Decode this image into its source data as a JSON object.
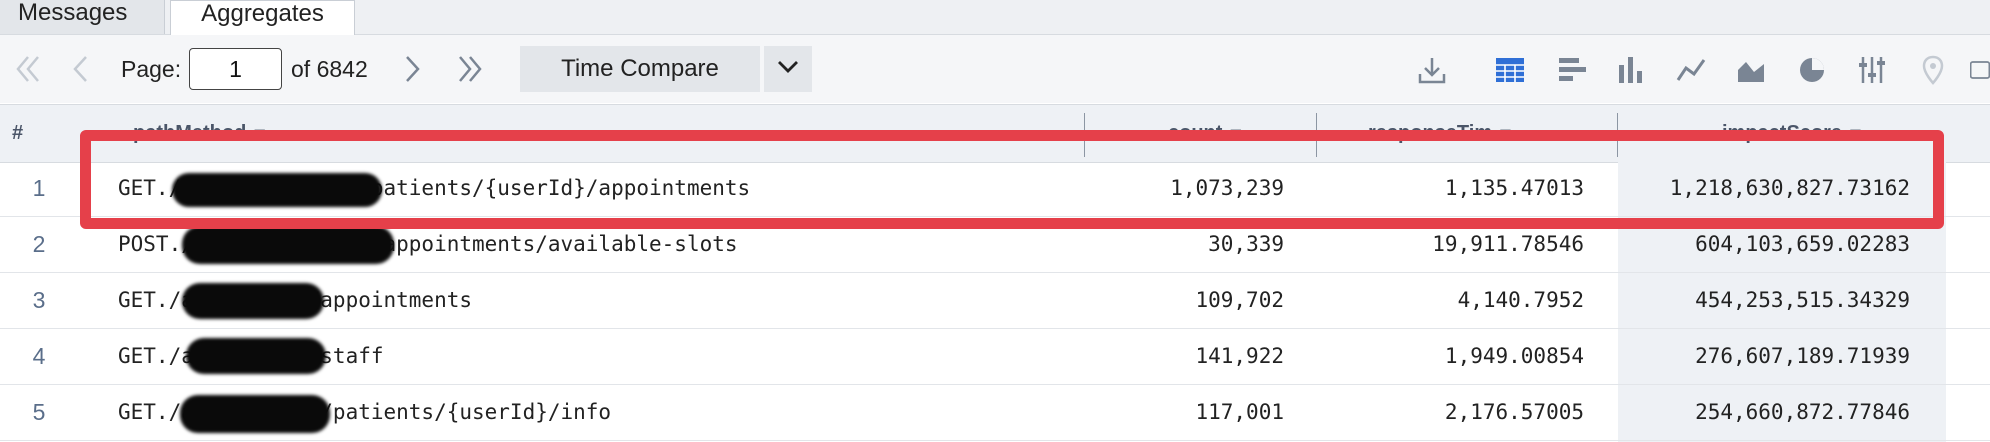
{
  "tabs": [
    {
      "label": "Messages"
    },
    {
      "label": "Aggregates"
    }
  ],
  "toolbar": {
    "page_label": "Page:",
    "page_value": "1",
    "of_text": "of 6842",
    "compare_label": "Time Compare"
  },
  "table": {
    "index_header": "#",
    "columns": [
      {
        "label": "pathMethod"
      },
      {
        "label": "count"
      },
      {
        "label": "responseTim"
      },
      {
        "label": "impactScore"
      }
    ],
    "rows": [
      {
        "index": "1",
        "path": "GET./api/v1/serv-ic/patients/{userId}/appointments",
        "count": "1,073,239",
        "responseTime": "1,135.47013",
        "impactScore": "1,218,630,827.73162"
      },
      {
        "index": "2",
        "path": "POST./api/v1/service/appointments/available-slots",
        "count": "30,339",
        "responseTime": "19,911.78546",
        "impactScore": "604,103,659.02283"
      },
      {
        "index": "3",
        "path": "GET./api/v1/red/appointments",
        "count": "109,702",
        "responseTime": "4,140.7952",
        "impactScore": "454,253,515.34329"
      },
      {
        "index": "4",
        "path": "GET./api/v1/mod/staff",
        "count": "141,922",
        "responseTime": "1,949.00854",
        "impactScore": "276,607,189.71939"
      },
      {
        "index": "5",
        "path": "GET./api/v1/serv/patients/{userId}/info",
        "count": "117,001",
        "responseTime": "2,176.57005",
        "impactScore": "254,660,872.77846"
      }
    ]
  },
  "icons": [
    "first-page-icon",
    "prev-page-icon",
    "next-page-icon",
    "last-page-icon",
    "chevron-down-icon",
    "download-icon",
    "table-view-icon",
    "bar-horizontal-icon",
    "bar-vertical-icon",
    "line-chart-icon",
    "area-chart-icon",
    "pie-chart-icon",
    "settings-sliders-icon",
    "map-pin-icon",
    "single-value-icon"
  ],
  "colors": {
    "highlight": "#e5404a",
    "header_bg": "#eef1f5",
    "accent_blue": "#2f6fd6"
  }
}
